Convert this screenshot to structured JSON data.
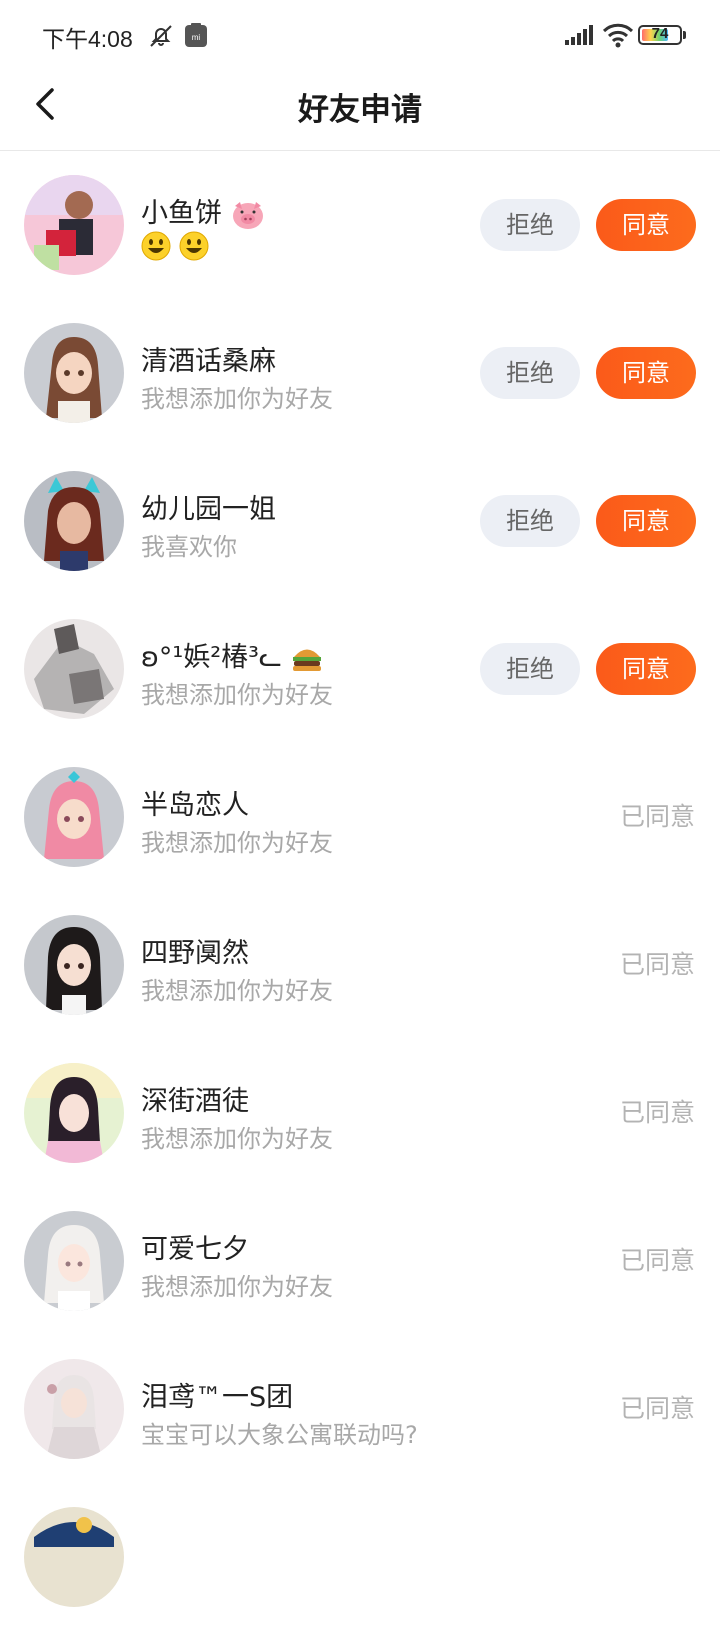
{
  "status_bar": {
    "time": "下午4:08",
    "battery": "74",
    "icons": [
      "mute-bell-icon",
      "mi-app-icon",
      "signal-icon",
      "wifi-icon",
      "battery-icon"
    ]
  },
  "header": {
    "title": "好友申请",
    "back_icon": "chevron-left-icon"
  },
  "colors": {
    "accept_button": "#fb5a1a",
    "reject_button_bg": "#eceff5",
    "accepted_text": "#b3b3b3",
    "message_text": "#a8a8a8"
  },
  "requests": [
    {
      "name": "小鱼饼",
      "name_emoji": "pig-face-emoji",
      "message_emoji": "smiley-emoji-x2",
      "reject_label": "拒绝",
      "accept_label": "同意"
    },
    {
      "name": "清酒话桑麻",
      "message": "我想添加你为好友",
      "reject_label": "拒绝",
      "accept_label": "同意"
    },
    {
      "name": "幼儿园一姐",
      "message": "我喜欢你",
      "reject_label": "拒绝",
      "accept_label": "同意"
    },
    {
      "name": "ʚ°¹娦²椿³ᓚ",
      "name_emoji": "burger-emoji",
      "message": "我想添加你为好友",
      "reject_label": "拒绝",
      "accept_label": "同意"
    },
    {
      "name": "半岛恋人",
      "message": "我想添加你为好友",
      "status": "已同意"
    },
    {
      "name": "四野阒然",
      "message": "我想添加你为好友",
      "status": "已同意"
    },
    {
      "name": "深街酒徒",
      "message": "我想添加你为好友",
      "status": "已同意"
    },
    {
      "name": "可爱七夕",
      "message": "我想添加你为好友",
      "status": "已同意"
    },
    {
      "name": "泪鸢™一S团",
      "message": "宝宝可以大象公寓联动吗?",
      "status": "已同意"
    }
  ]
}
